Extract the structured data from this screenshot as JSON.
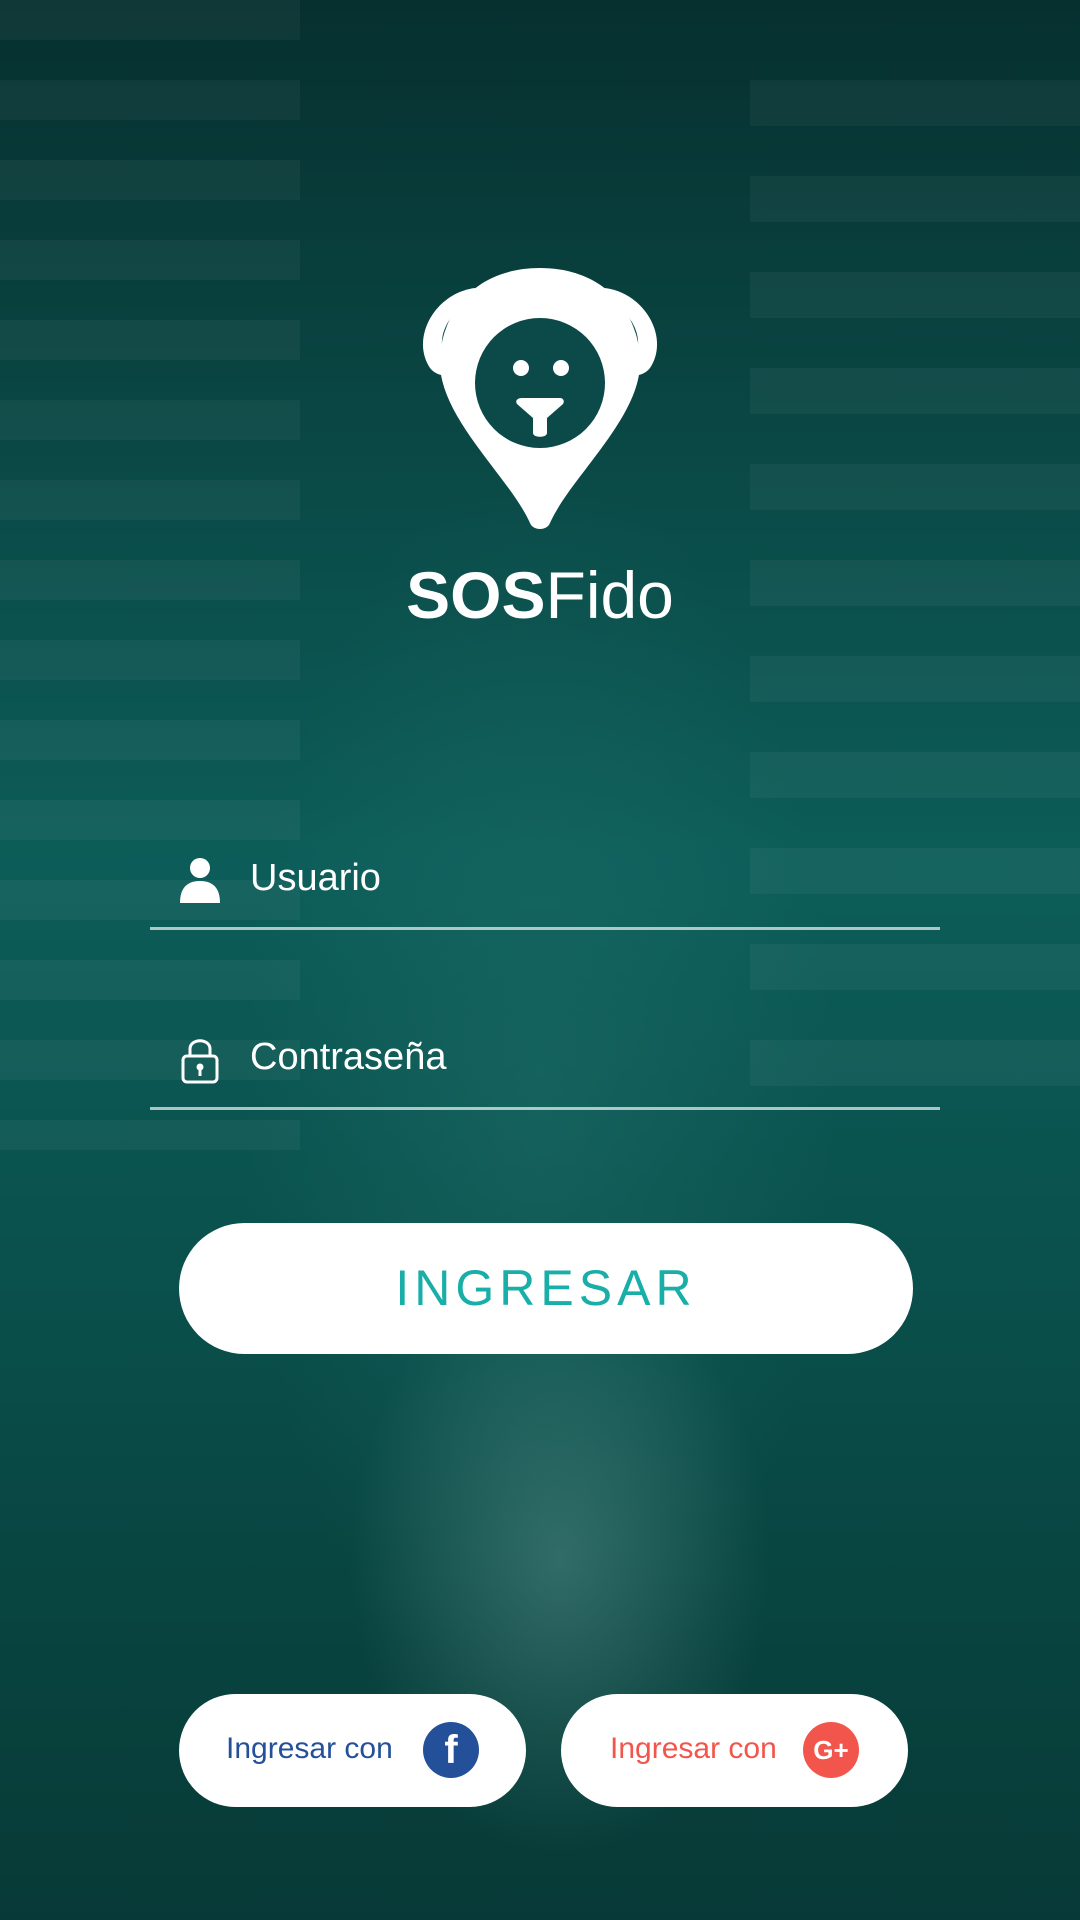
{
  "app": {
    "brand_bold": "SOS",
    "brand_light": "Fido"
  },
  "login": {
    "username_placeholder": "Usuario",
    "password_placeholder": "Contraseña",
    "submit_label": "INGRESAR"
  },
  "social": {
    "facebook_label": "Ingresar con",
    "facebook_icon_text": "f",
    "google_label": "Ingresar con",
    "google_icon_text": "G+"
  },
  "colors": {
    "accent": "#1aaea9",
    "facebook": "#24509a",
    "google": "#f2554b",
    "overlay": "#0b4a48"
  },
  "icons": [
    "dog-pin-logo-icon",
    "user-icon",
    "lock-icon",
    "facebook-icon",
    "google-plus-icon"
  ]
}
